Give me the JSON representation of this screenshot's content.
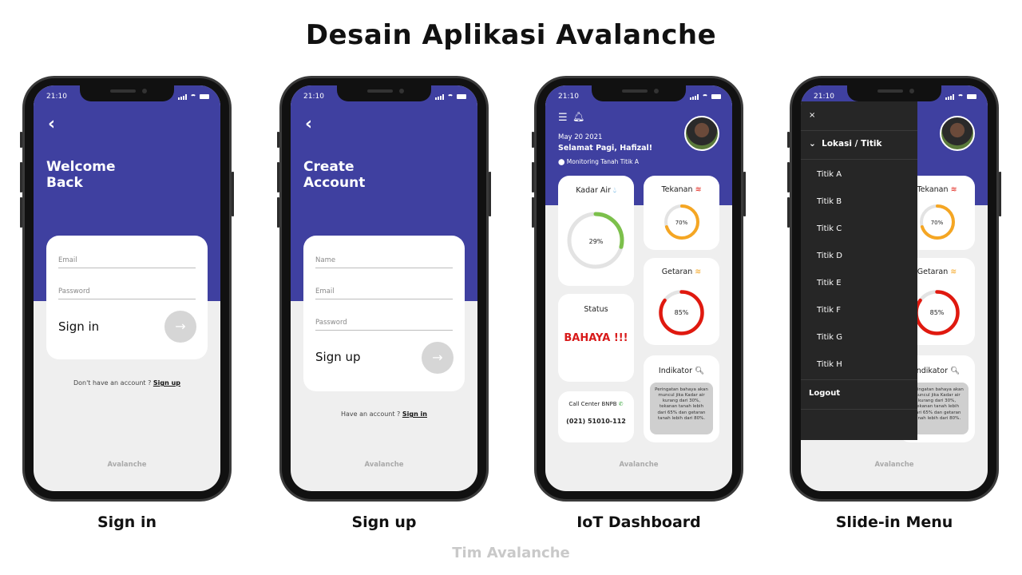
{
  "title": "Desain Aplikasi Avalanche",
  "footer": "Tim Avalanche",
  "status_time": "21:10",
  "brand": "Avalanche",
  "signin": {
    "caption": "Sign in",
    "heading": "Welcome\nBack",
    "email_placeholder": "Email",
    "password_placeholder": "Password",
    "action": "Sign in",
    "alt_text": "Don't have an account ?",
    "alt_link": "Sign up"
  },
  "signup": {
    "caption": "Sign up",
    "heading": "Create\nAccount",
    "name_placeholder": "Name",
    "email_placeholder": "Email",
    "password_placeholder": "Password",
    "action": "Sign up",
    "alt_text": "Have an account ?",
    "alt_link": "Sign in"
  },
  "dashboard": {
    "caption": "IoT Dashboard",
    "date": "May 20 2021",
    "greeting": "Selamat Pagi, Hafizal!",
    "location": "Monitoring Tanah Titik A",
    "kadar_air": {
      "label": "Kadar Air",
      "value": "29%",
      "percent": 29
    },
    "tekanan": {
      "label": "Tekanan",
      "value": "70%",
      "percent": 70
    },
    "getaran": {
      "label": "Getaran",
      "value": "85%",
      "percent": 85
    },
    "status": {
      "label": "Status",
      "value": "BAHAYA !!!"
    },
    "call_center": {
      "label": "Call Center BNPB",
      "phone": "(021) 51010-112"
    },
    "indikator": {
      "label": "Indikator",
      "text": "Peringatan bahaya akan muncul jika Kadar air kurang dari 30%, tekanan tanah lebih dari 65% dan getaran tanah lebih dari 80%."
    },
    "colors": {
      "primary": "#3f40a0",
      "kadar_air": "#7cc04b",
      "tekanan": "#f5a623",
      "getaran": "#e0190f",
      "danger": "#d81a1a"
    }
  },
  "menu": {
    "caption": "Slide-in Menu",
    "close": "×",
    "section": "Lokasi / Titik",
    "items": [
      "Titik A",
      "Titik B",
      "Titik C",
      "Titik D",
      "Titik E",
      "Titik F",
      "Titik G",
      "Titik H"
    ],
    "logout": "Logout"
  }
}
